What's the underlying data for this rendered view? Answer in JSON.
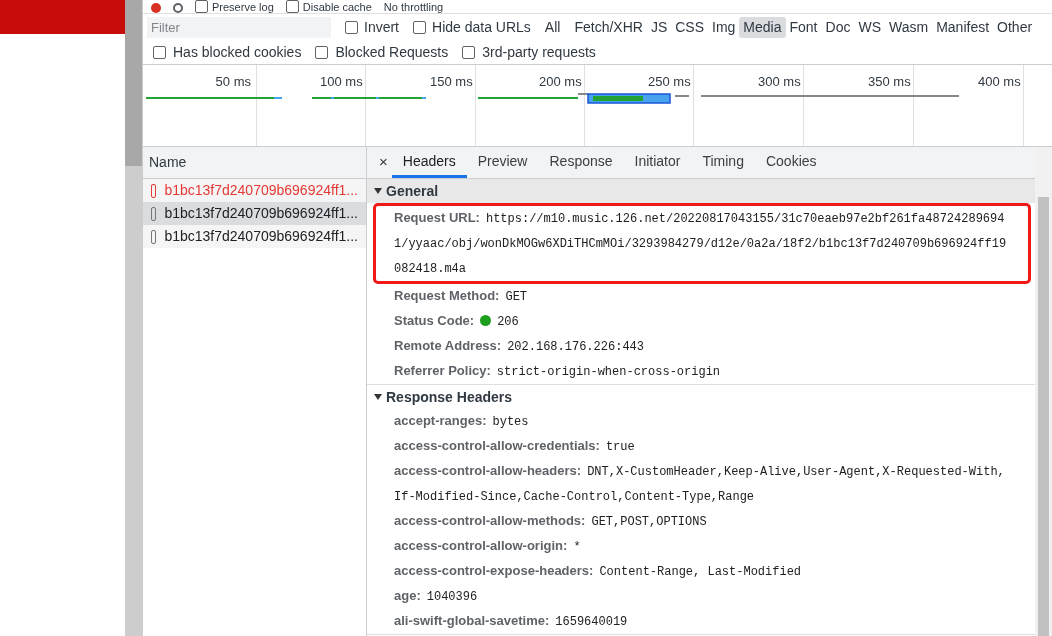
{
  "toolbar": {
    "items": [
      {
        "label": "Preserve log",
        "checked": false
      },
      {
        "label": "Disable cache",
        "checked": false
      }
    ],
    "throttling": "No throttling"
  },
  "filter": {
    "placeholder": "Filter",
    "invert": {
      "label": "Invert",
      "checked": false
    },
    "hide_data_urls": {
      "label": "Hide data URLs",
      "checked": false
    },
    "types": [
      {
        "label": "All",
        "selected": false
      },
      {
        "label": "Fetch/XHR",
        "selected": false
      },
      {
        "label": "JS",
        "selected": false
      },
      {
        "label": "CSS",
        "selected": false
      },
      {
        "label": "Img",
        "selected": false
      },
      {
        "label": "Media",
        "selected": true
      },
      {
        "label": "Font",
        "selected": false
      },
      {
        "label": "Doc",
        "selected": false
      },
      {
        "label": "WS",
        "selected": false
      },
      {
        "label": "Wasm",
        "selected": false
      },
      {
        "label": "Manifest",
        "selected": false
      },
      {
        "label": "Other",
        "selected": false
      }
    ]
  },
  "options": [
    {
      "label": "Has blocked cookies",
      "checked": false
    },
    {
      "label": "Blocked Requests",
      "checked": false
    },
    {
      "label": "3rd-party requests",
      "checked": false
    }
  ],
  "timeline": {
    "ticks": [
      "50 ms",
      "100 ms",
      "150 ms",
      "200 ms",
      "250 ms",
      "300 ms",
      "350 ms",
      "400 ms"
    ]
  },
  "requests": {
    "column": "Name",
    "rows": [
      {
        "name": "b1bc13f7d240709b696924ff1...",
        "failed": true,
        "selected": false
      },
      {
        "name": "b1bc13f7d240709b696924ff1...",
        "failed": false,
        "selected": true
      },
      {
        "name": "b1bc13f7d240709b696924ff1...",
        "failed": false,
        "selected": false
      }
    ]
  },
  "close": "×",
  "tabs": [
    {
      "label": "Headers",
      "selected": true
    },
    {
      "label": "Preview",
      "selected": false
    },
    {
      "label": "Response",
      "selected": false
    },
    {
      "label": "Initiator",
      "selected": false
    },
    {
      "label": "Timing",
      "selected": false
    },
    {
      "label": "Cookies",
      "selected": false
    }
  ],
  "sections": [
    {
      "title": "General",
      "expanded": true,
      "rows": [
        {
          "name": "Request URL:",
          "value": "https://m10.music.126.net/20220817043155/31c70eaeb97e2bf261fa487242896941/yyaac/obj/wonDkMOGw6XDiTHCmMOi/3293984279/d12e/0a2a/18f2/b1bc13f7d240709b696924ff19082418.m4a",
          "highlighted": true
        },
        {
          "name": "Request Method:",
          "value": "GET",
          "highlighted": false
        },
        {
          "name": "Status Code:",
          "value": "206",
          "indicator": true,
          "highlighted": false
        },
        {
          "name": "Remote Address:",
          "value": "202.168.176.226:443",
          "highlighted": false
        },
        {
          "name": "Referrer Policy:",
          "value": "strict-origin-when-cross-origin",
          "highlighted": false
        }
      ]
    },
    {
      "title": "Response Headers",
      "expanded": true,
      "rows": [
        {
          "name": "accept-ranges:",
          "value": "bytes",
          "highlighted": false
        },
        {
          "name": "access-control-allow-credentials:",
          "value": "true",
          "highlighted": false
        },
        {
          "name": "access-control-allow-headers:",
          "value": "DNT,X-CustomHeader,Keep-Alive,User-Agent,X-Requested-With,If-Modified-Since,Cache-Control,Content-Type,Range",
          "highlighted": false
        },
        {
          "name": "access-control-allow-methods:",
          "value": "GET,POST,OPTIONS",
          "highlighted": false
        },
        {
          "name": "access-control-allow-origin:",
          "value": "*",
          "highlighted": false
        },
        {
          "name": "access-control-expose-headers:",
          "value": "Content-Range, Last-Modified",
          "highlighted": false
        },
        {
          "name": "age:",
          "value": "1040396",
          "highlighted": false
        },
        {
          "name": "ali-swift-global-savetime:",
          "value": "1659640019",
          "highlighted": false
        }
      ]
    }
  ]
}
